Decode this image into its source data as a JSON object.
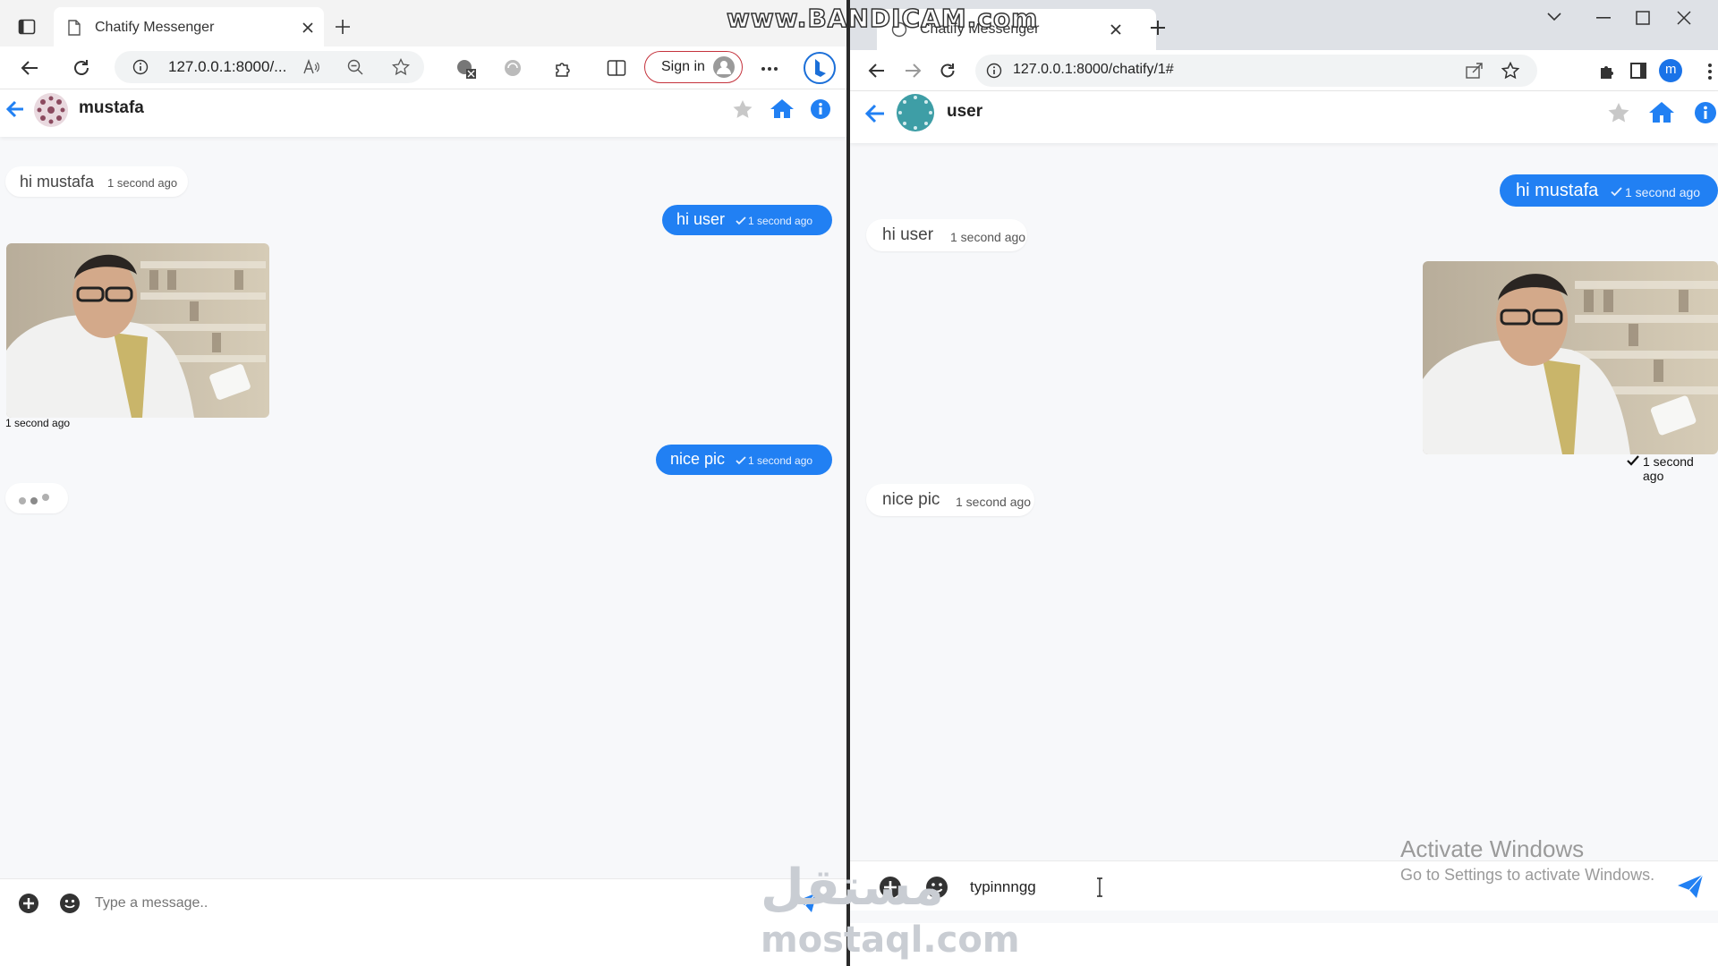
{
  "watermarks": {
    "bandicam": "www.BANDICAM.com",
    "mostaql_ar": "مستقل",
    "mostaql_en": "mostaql.com",
    "activate_title": "Activate Windows",
    "activate_sub": "Go to Settings to activate Windows."
  },
  "left_browser": {
    "tab_title": "Chatify Messenger",
    "url": "127.0.0.1:8000/...",
    "signin_label": "Sign in"
  },
  "right_browser": {
    "tab_title": "Chatify Messenger",
    "url": "127.0.0.1:8000/chatify/1#",
    "profile_initial": "m"
  },
  "left_chat": {
    "contact_name": "mustafa",
    "messages": [
      {
        "dir": "in",
        "text": "hi mustafa",
        "time": "1 second ago"
      },
      {
        "dir": "out",
        "text": "hi user",
        "time": "1 second ago"
      },
      {
        "dir": "in-image",
        "time": "1 second ago"
      },
      {
        "dir": "out",
        "text": "nice pic",
        "time": "1 second ago"
      }
    ],
    "composer_placeholder": "Type a message.."
  },
  "right_chat": {
    "contact_name": "user",
    "messages": [
      {
        "dir": "out",
        "text": "hi mustafa",
        "time": "1 second ago"
      },
      {
        "dir": "in",
        "text": "hi user",
        "time": "1 second ago"
      },
      {
        "dir": "out-image",
        "time": "1 second ago"
      },
      {
        "dir": "in",
        "text": "nice pic",
        "time": "1 second ago"
      }
    ],
    "composer_value": "typinnngg"
  },
  "colors": {
    "accent_blue": "#2180f3",
    "chat_bg": "#f7f8fa",
    "header_icon_blue": "#2180f3",
    "star_gray": "#c8c8c8"
  }
}
